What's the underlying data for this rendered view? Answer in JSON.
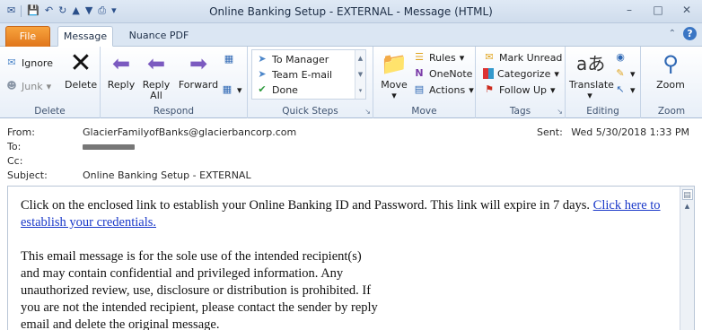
{
  "window": {
    "title": "Online Banking Setup - EXTERNAL  -  Message (HTML)",
    "controls": [
      "–",
      "□",
      "✕"
    ]
  },
  "tabs": {
    "file": "File",
    "message": "Message",
    "nuance": "Nuance PDF"
  },
  "ribbon": {
    "delete_group": {
      "label": "Delete",
      "ignore": "Ignore",
      "junk": "Junk",
      "delete": "Delete"
    },
    "respond_group": {
      "label": "Respond",
      "reply": "Reply",
      "reply_all_1": "Reply",
      "reply_all_2": "All",
      "forward": "Forward"
    },
    "quick_steps_group": {
      "label": "Quick Steps",
      "items": [
        "To Manager",
        "Team E-mail",
        "Done"
      ]
    },
    "move_group": {
      "label": "Move",
      "move": "Move",
      "rules": "Rules",
      "onenote": "OneNote",
      "actions": "Actions"
    },
    "tags_group": {
      "label": "Tags",
      "mark_unread": "Mark Unread",
      "categorize": "Categorize",
      "follow_up": "Follow Up"
    },
    "editing_group": {
      "label": "Editing",
      "translate": "Translate"
    },
    "zoom_group": {
      "label": "Zoom",
      "zoom": "Zoom"
    }
  },
  "header": {
    "from_label": "From:",
    "from_value": "GlacierFamilyofBanks@glacierbancorp.com",
    "to_label": "To:",
    "cc_label": "Cc:",
    "subject_label": "Subject:",
    "subject_value": "Online Banking Setup - EXTERNAL",
    "sent_label": "Sent:",
    "sent_value": "Wed 5/30/2018 1:33 PM"
  },
  "body": {
    "para1_text": "Click on the enclosed link to establish your Online Banking ID and Password. This link will expire in 7 days. ",
    "para1_link": "Click here to establish your credentials.",
    "disclaimer_lines": [
      "This email message is for the sole use of the intended recipient(s)",
      "and may contain confidential and privileged information. Any",
      "unauthorized review, use, disclosure or distribution is prohibited. If",
      "you are not the intended recipient, please contact the sender by reply",
      "email and delete the original message."
    ]
  }
}
